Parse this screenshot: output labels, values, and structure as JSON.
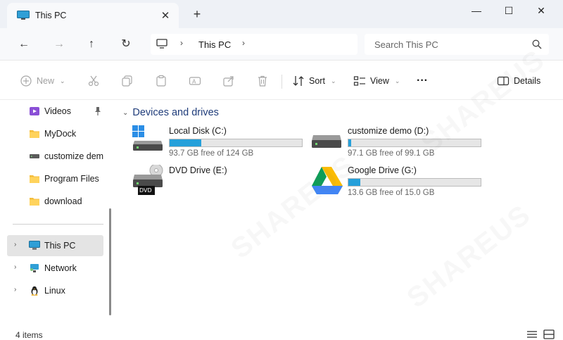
{
  "tab": {
    "title": "This PC",
    "close_glyph": "✕",
    "new_tab_glyph": "+"
  },
  "window": {
    "minimize_glyph": "—",
    "maximize_glyph": "☐",
    "close_glyph": "✕"
  },
  "nav": {
    "back_glyph": "←",
    "forward_glyph": "→",
    "up_glyph": "↑",
    "refresh_glyph": "↻",
    "address_crumb": "This PC",
    "chevron_glyph": "›",
    "search_placeholder": "Search This PC"
  },
  "commands": {
    "new_label": "New",
    "sort_label": "Sort",
    "view_label": "View",
    "more_glyph": "···",
    "details_label": "Details"
  },
  "sidebar": {
    "items": [
      {
        "label": "Videos",
        "icon": "videos-folder-icon",
        "pinned": true
      },
      {
        "label": "MyDock",
        "icon": "folder-icon"
      },
      {
        "label": "customize demo",
        "icon": "drive-icon"
      },
      {
        "label": "Program Files",
        "icon": "folder-icon"
      },
      {
        "label": "download",
        "icon": "folder-icon"
      }
    ],
    "tree": [
      {
        "label": "This PC",
        "icon": "pc-icon",
        "selected": true
      },
      {
        "label": "Network",
        "icon": "network-icon"
      },
      {
        "label": "Linux",
        "icon": "linux-penguin-icon"
      }
    ]
  },
  "main": {
    "group_title": "Devices and drives",
    "drives": [
      {
        "name": "Local Disk (C:)",
        "free": "93.7 GB free of 124 GB",
        "used_fraction": 0.24,
        "icon": "windows-drive-icon"
      },
      {
        "name": "customize demo (D:)",
        "free": "97.1 GB free of 99.1 GB",
        "used_fraction": 0.02,
        "icon": "drive-icon"
      },
      {
        "name": "DVD Drive (E:)",
        "icon": "dvd-drive-icon",
        "badge": "DVD"
      },
      {
        "name": "Google Drive (G:)",
        "free": "13.6 GB free of 15.0 GB",
        "used_fraction": 0.09,
        "icon": "google-drive-icon"
      }
    ]
  },
  "status": {
    "count": "4 items"
  },
  "colors": {
    "accent": "#26a0da",
    "group_header": "#1f3c7a",
    "selected_bg": "#e4e4e4"
  },
  "watermark_text": "SHAREUS"
}
